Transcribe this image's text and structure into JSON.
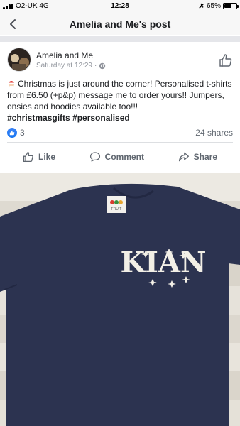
{
  "status_bar": {
    "carrier": "O2-UK 4G",
    "time": "12:28",
    "battery": "65%",
    "battery_level": 0.65
  },
  "nav": {
    "title": "Amelia and Me's post"
  },
  "post": {
    "author": "Amelia and Me",
    "timestamp": "Saturday at 12:29",
    "text": "Christmas is just around the corner! Personalised t-shirts from £6.50 (+p&p) message me to order yours!! Jumpers, onsies and hoodies available too!!!",
    "hashtags": "#christmasgifts #personalised",
    "reaction_count": "3",
    "shares": "24 shares"
  },
  "actions": {
    "like": "Like",
    "comment": "Comment",
    "share": "Share"
  },
  "photo": {
    "shirt_print": "KIAN",
    "label_text": "FRUIT",
    "shirt_color": "#2c3350",
    "print_color": "#f2efe6"
  },
  "colors": {
    "facebook_blue": "#1877f2",
    "muted_text": "#606770",
    "divider": "#dddfe2"
  }
}
